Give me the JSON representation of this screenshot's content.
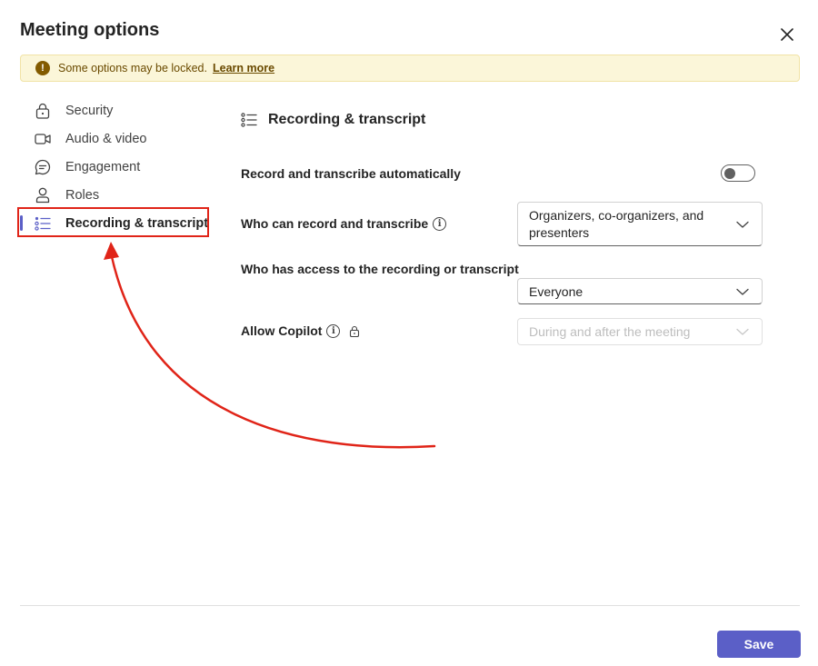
{
  "dialog": {
    "title": "Meeting options"
  },
  "banner": {
    "icon": "warning-icon",
    "message": "Some options may be locked.",
    "link_label": "Learn more"
  },
  "sidebar": {
    "items": [
      {
        "label": "Security",
        "icon": "lock-icon",
        "active": false
      },
      {
        "label": "Audio & video",
        "icon": "video-camera-icon",
        "active": false
      },
      {
        "label": "Engagement",
        "icon": "chat-bubble-icon",
        "active": false
      },
      {
        "label": "Roles",
        "icon": "person-icon",
        "active": false
      },
      {
        "label": "Recording & transcript",
        "icon": "list-icon",
        "active": true
      }
    ]
  },
  "section": {
    "title": "Recording & transcript",
    "icon": "list-icon"
  },
  "options": {
    "record_auto": {
      "label": "Record and transcribe automatically",
      "enabled": false
    },
    "who_can_record": {
      "label": "Who can record and transcribe",
      "value": "Organizers, co-organizers, and presenters"
    },
    "who_has_access": {
      "label": "Who has access to the recording or transcript",
      "value": "Everyone"
    },
    "allow_copilot": {
      "label": "Allow Copilot",
      "value": "During and after the meeting",
      "locked": true
    }
  },
  "footer": {
    "save_label": "Save"
  },
  "colors": {
    "accent": "#5b5fc7",
    "annotation": "#e02418",
    "banner_bg": "#fbf6d9"
  }
}
